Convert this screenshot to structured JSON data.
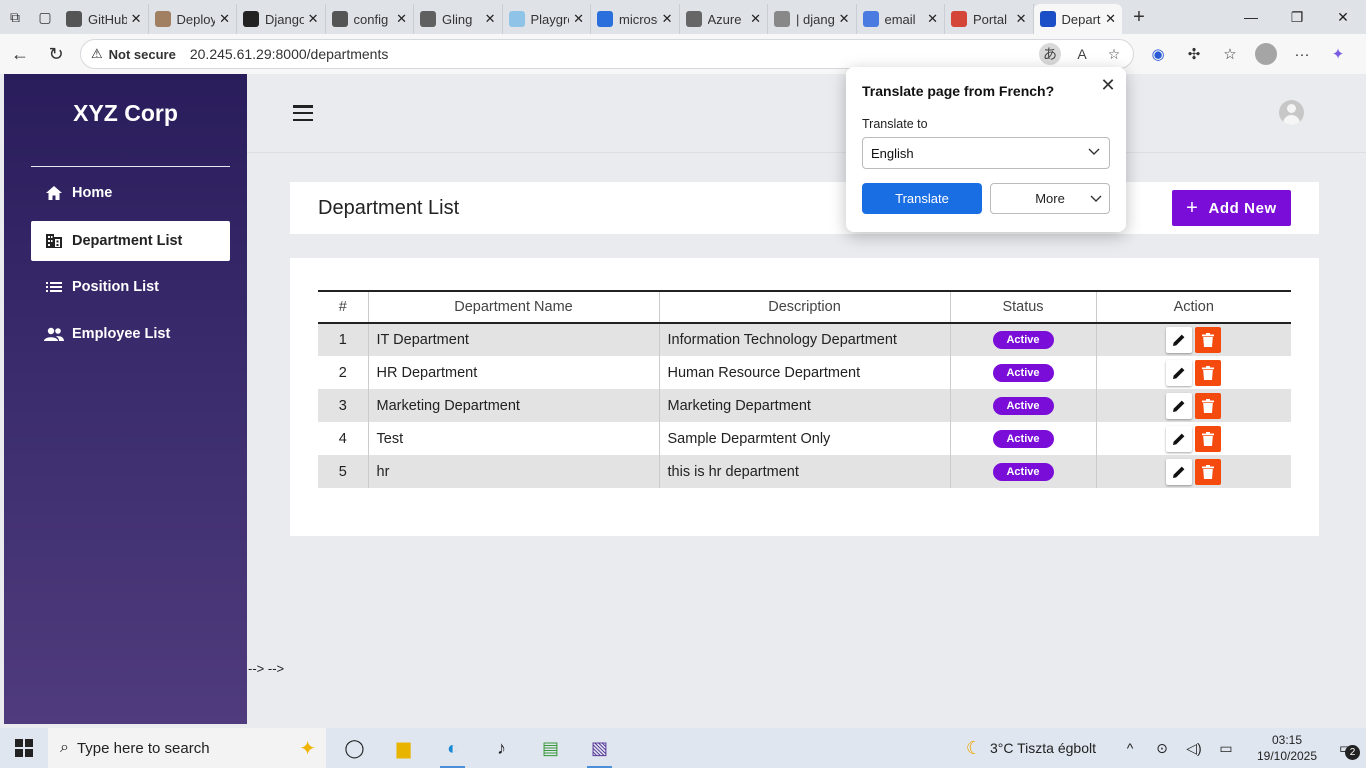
{
  "browser": {
    "tabs": [
      {
        "title": "GitHub",
        "favicon_color": "#555555",
        "icon": "github-icon"
      },
      {
        "title": "Deploy",
        "favicon_color": "#a08060",
        "icon": "image-icon"
      },
      {
        "title": "Django",
        "favicon_color": "#222222",
        "icon": "github-icon"
      },
      {
        "title": "config",
        "favicon_color": "#555555",
        "icon": "github-icon"
      },
      {
        "title": "Gling",
        "favicon_color": "#606060",
        "icon": "plus-square-icon"
      },
      {
        "title": "Playground",
        "favicon_color": "#8fc3e8",
        "icon": "cloud-icon"
      },
      {
        "title": "microsoft",
        "favicon_color": "#2a6fdb",
        "icon": "azure-icon"
      },
      {
        "title": "Azure",
        "favicon_color": "#666666",
        "icon": "openai-icon"
      },
      {
        "title": "| django",
        "favicon_color": "#888888",
        "icon": "page-icon"
      },
      {
        "title": "email",
        "favicon_color": "#4a7be0",
        "icon": "search-icon"
      },
      {
        "title": "Portal",
        "favicon_color": "#d44638",
        "icon": "gmail-icon"
      },
      {
        "title": "Departments",
        "favicon_color": "#1a4fc7",
        "icon": "bootstrap-icon"
      }
    ],
    "active_tab_index": 11,
    "address": {
      "security_label": "Not secure",
      "url": "20.245.61.29:8000/departments"
    }
  },
  "sidebar": {
    "brand": "XYZ Corp",
    "items": [
      {
        "label": "Home",
        "icon": "home-icon",
        "active": false
      },
      {
        "label": "Department List",
        "icon": "building-icon",
        "active": true
      },
      {
        "label": "Position List",
        "icon": "list-icon",
        "active": false
      },
      {
        "label": "Employee List",
        "icon": "users-icon",
        "active": false
      }
    ]
  },
  "main": {
    "page_title": "Department List",
    "add_button_label": "Add New",
    "table": {
      "columns": [
        "#",
        "Department Name",
        "Description",
        "Status",
        "Action"
      ],
      "rows": [
        {
          "num": "1",
          "name": "IT Department",
          "description": "Information Technology Department",
          "status": "Active"
        },
        {
          "num": "2",
          "name": "HR Department",
          "description": "Human Resource Department",
          "status": "Active"
        },
        {
          "num": "3",
          "name": "Marketing Department",
          "description": "Marketing Department",
          "status": "Active"
        },
        {
          "num": "4",
          "name": "Test",
          "description": "Sample Deparmtent Only",
          "status": "Active"
        },
        {
          "num": "5",
          "name": "hr",
          "description": "this is hr department",
          "status": "Active"
        }
      ]
    },
    "stray_text": "--> -->"
  },
  "translate_popup": {
    "title": "Translate page from French?",
    "label": "Translate to",
    "selected_language": "English",
    "translate_button": "Translate",
    "more_button": "More"
  },
  "taskbar": {
    "search_placeholder": "Type here to search",
    "weather": "3°C  Tiszta égbolt",
    "time": "03:15",
    "date": "19/10/2025",
    "notifications": "2"
  },
  "colors": {
    "accent": "#7a0ed8",
    "delete": "#f44a0e",
    "sidebar_top": "#2a1d5c",
    "sidebar_bottom": "#4f3b7d",
    "translate_blue": "#1a6ee4"
  }
}
